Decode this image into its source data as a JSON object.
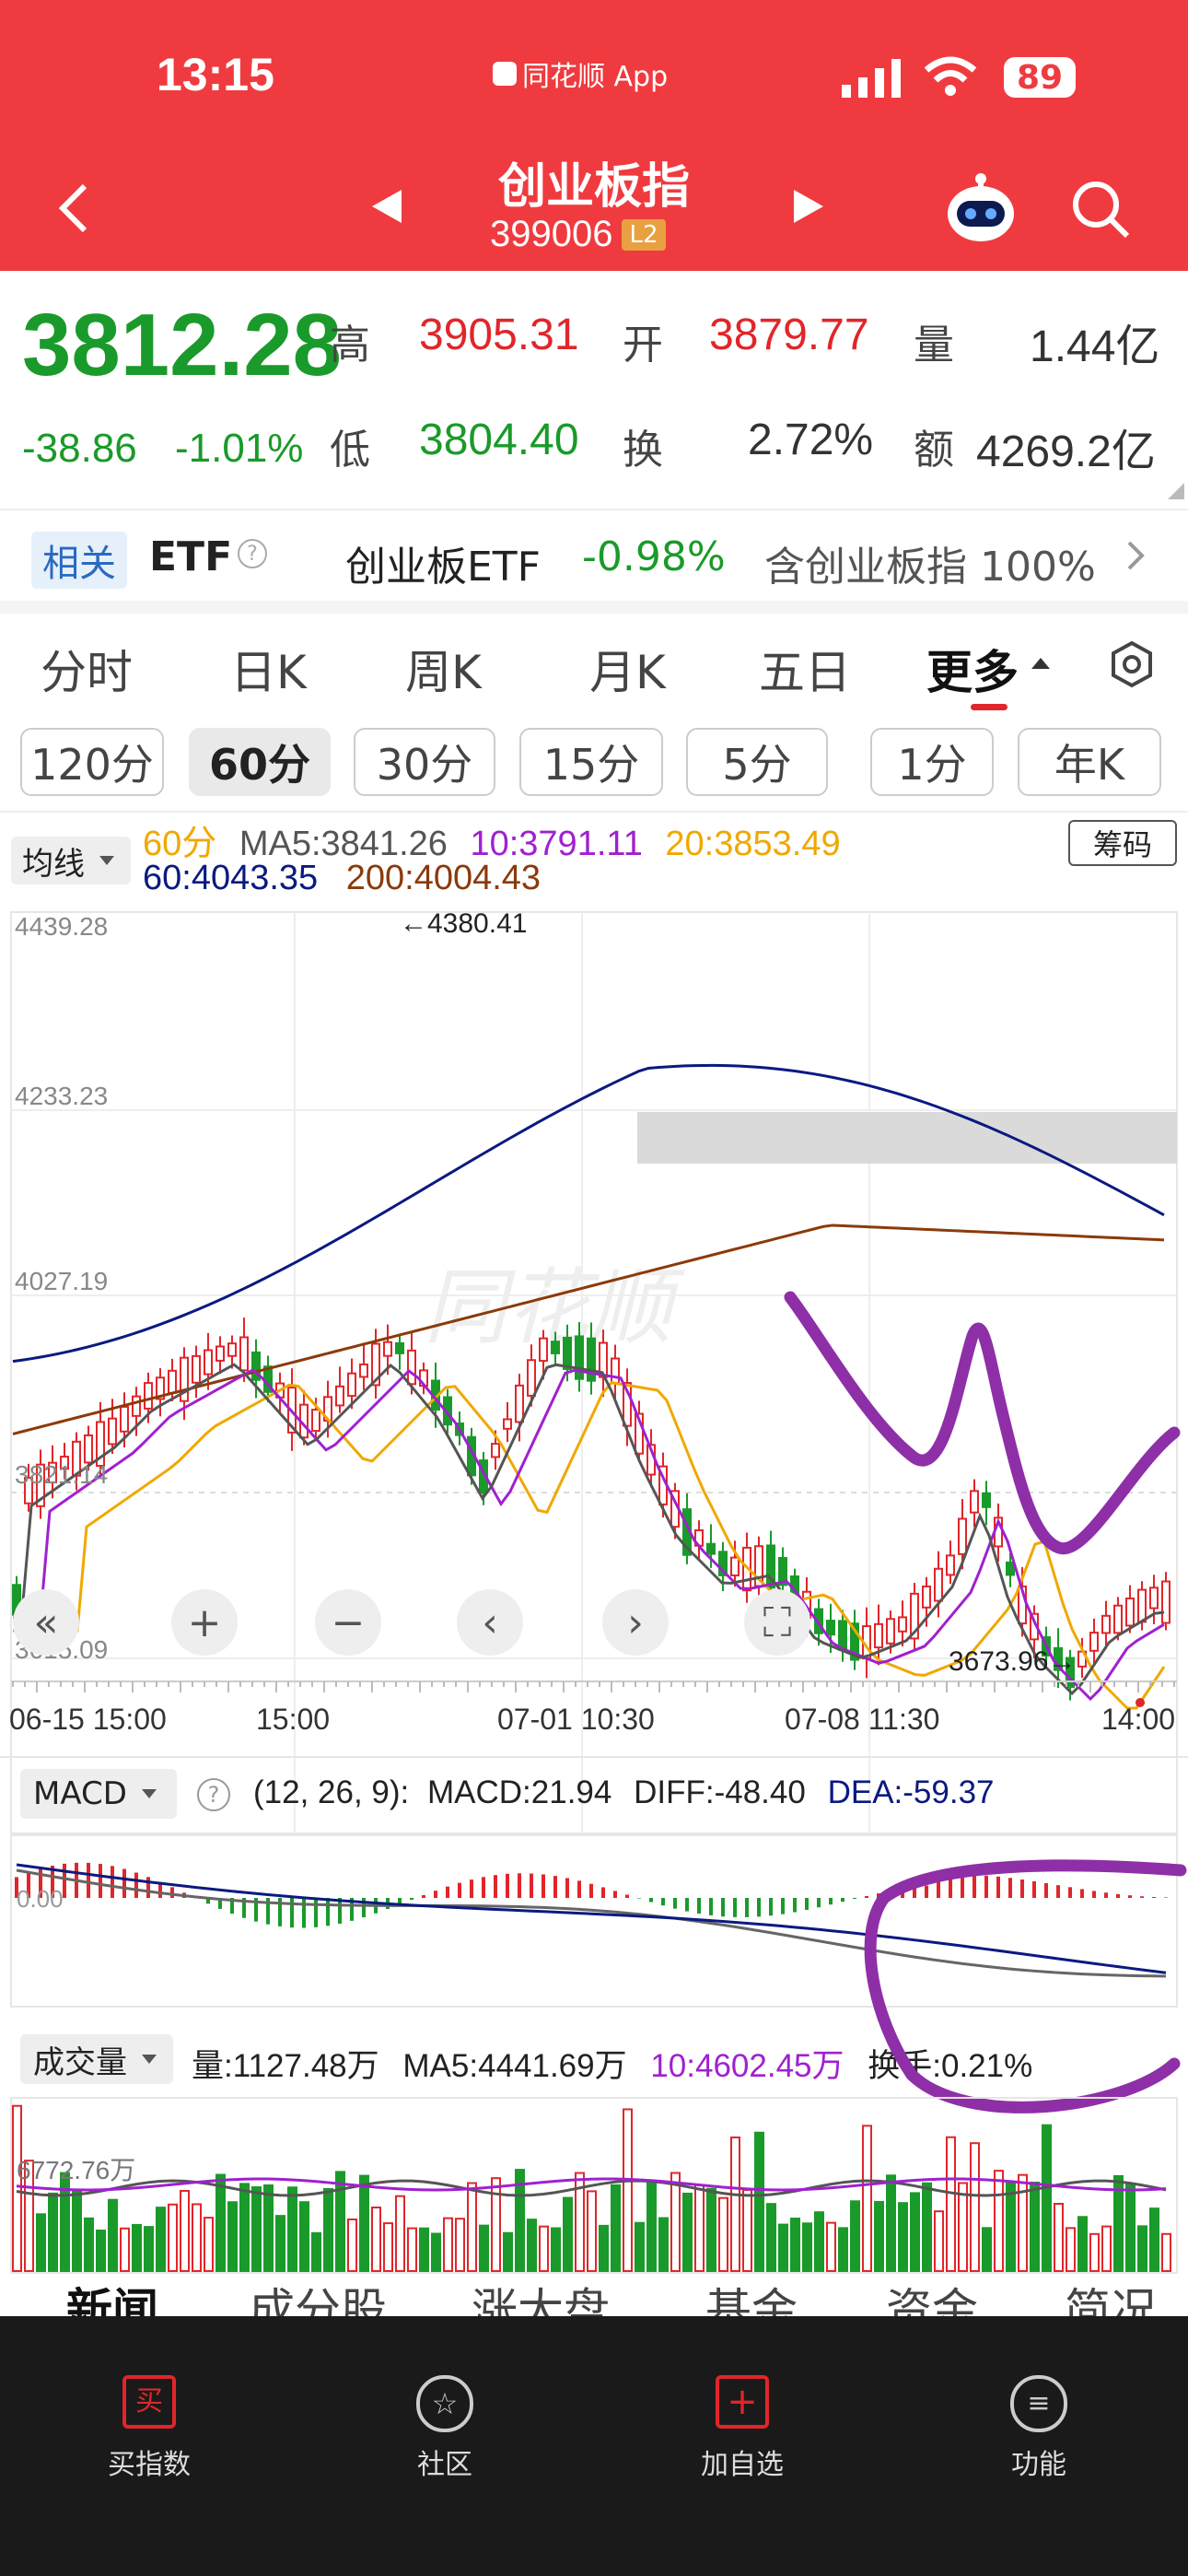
{
  "status": {
    "time": "13:15",
    "app": "同花顺 App",
    "battery": "89"
  },
  "nav": {
    "title": "创业板指",
    "code": "399006",
    "level_badge": "L2"
  },
  "quote": {
    "price": "3812.28",
    "change": "-38.86",
    "change_pct": "-1.01%",
    "high_label": "高",
    "high": "3905.31",
    "low_label": "低",
    "low": "3804.40",
    "open_label": "开",
    "open": "3879.77",
    "turnover_label": "换",
    "turnover": "2.72%",
    "volume_label": "量",
    "volume": "1.44亿",
    "amount_label": "额",
    "amount": "4269.2亿"
  },
  "etf": {
    "tag": "相关",
    "label": "ETF",
    "name": "创业板ETF",
    "change": "-0.98%",
    "holding": "含创业板指 100%"
  },
  "period_tabs": [
    "分时",
    "日K",
    "周K",
    "月K",
    "五日",
    "更多"
  ],
  "minute_tabs": [
    "120分",
    "60分",
    "30分",
    "15分",
    "5分",
    "1分",
    "年K"
  ],
  "ma_bar": {
    "selector": "均线",
    "period": "60分",
    "ma5": "MA5:3841.26",
    "ma10": "10:3791.11",
    "ma20": "20:3853.49",
    "ma60": "60:4043.35",
    "ma200": "200:4004.43",
    "chips": "筹码"
  },
  "kline": {
    "y_ticks": [
      "4439.28",
      "4233.23",
      "4027.19",
      "3821.14",
      "3615.09"
    ],
    "high_marker": "←4380.41",
    "low_marker": "3673.96→",
    "x_ticks": [
      "06-15 15:00",
      "15:00",
      "07-01 10:30",
      "07-08 11:30",
      "14:00"
    ],
    "watermark": "同花顺"
  },
  "macd": {
    "selector": "MACD",
    "params": "(12, 26, 9):",
    "macd": "MACD:21.94",
    "diff": "DIFF:-48.40",
    "dea": "DEA:-59.37",
    "axis": "0.00"
  },
  "volume": {
    "selector": "成交量",
    "vol": "量:1127.48万",
    "ma5": "MA5:4441.69万",
    "ma10": "10:4602.45万",
    "turnover": "换手:0.21%",
    "axis": "6772.76万"
  },
  "info_tabs": [
    "新闻",
    "成分股",
    "涨大盘",
    "基金",
    "资金",
    "简况"
  ],
  "bottom_nav": [
    "买指数",
    "社区",
    "加自选",
    "功能"
  ],
  "colors": {
    "header": "#ef3b3f",
    "up": "#e0262a",
    "down": "#1a9a2a",
    "ma5": "#555555",
    "ma10": "#a020d0",
    "ma20": "#f0a800",
    "ma60": "#0a1a80",
    "ma200": "#8b3a0a",
    "annotation": "#8e2fa8"
  }
}
